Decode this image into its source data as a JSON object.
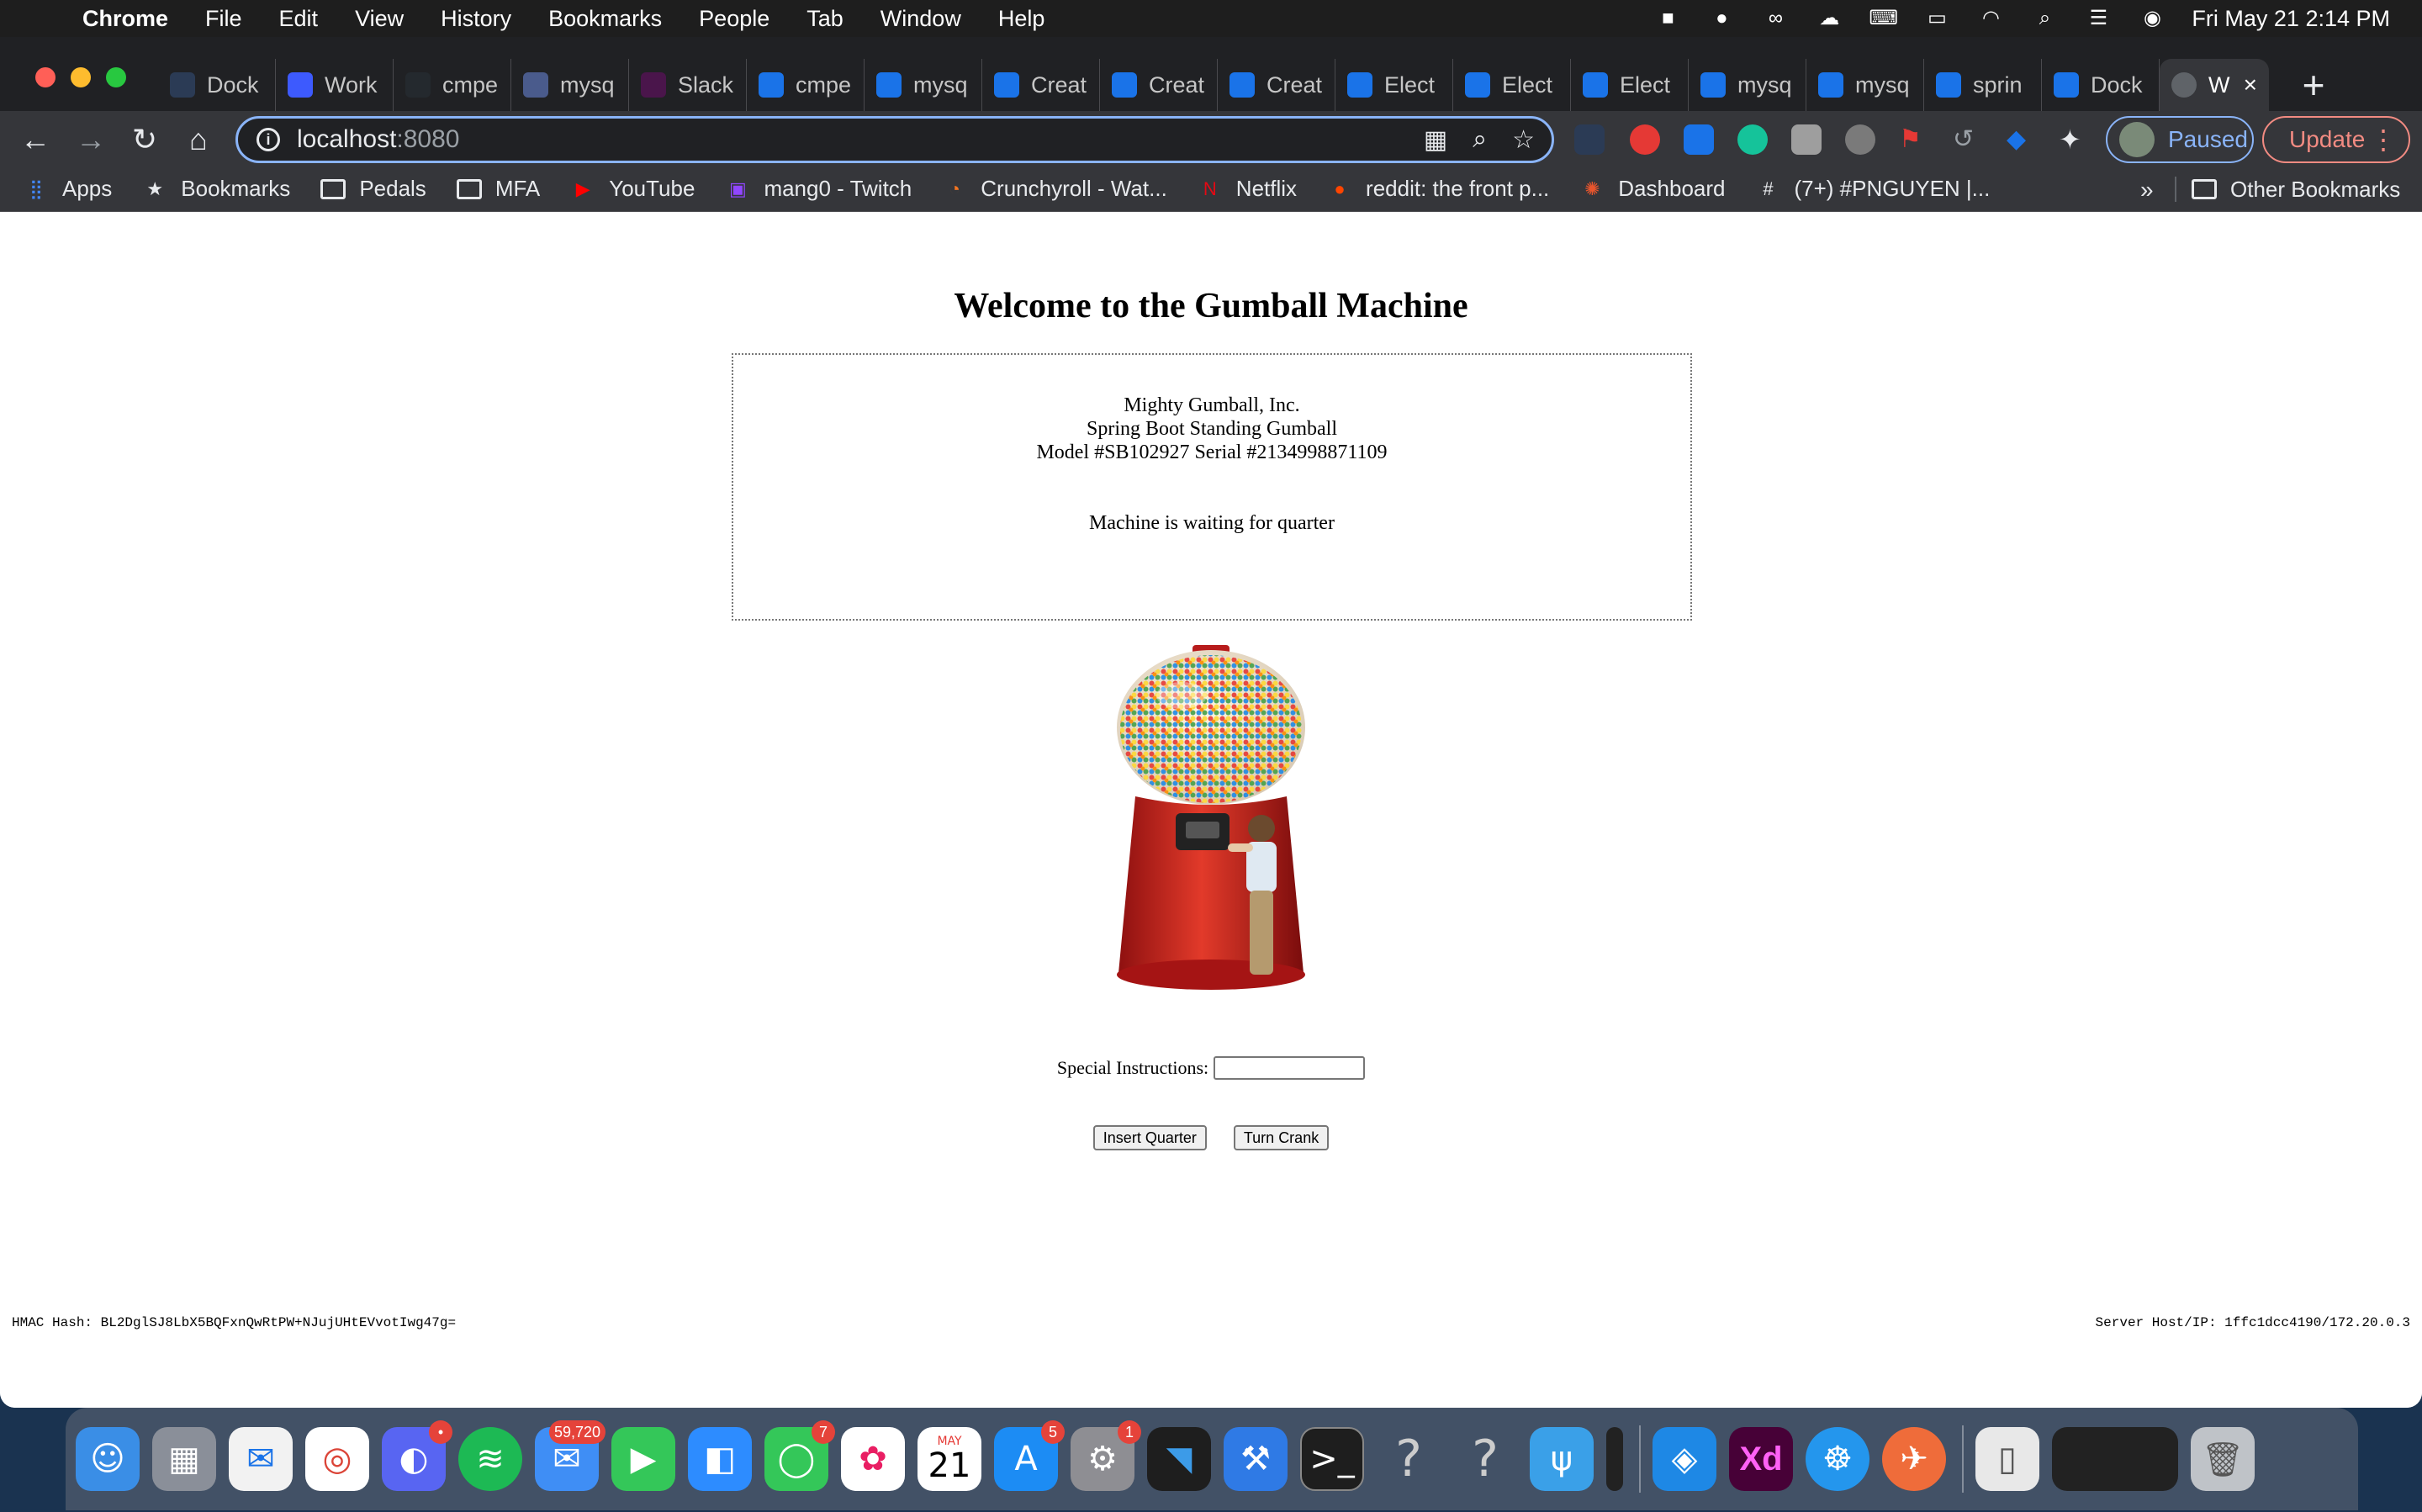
{
  "menubar": {
    "app": "Chrome",
    "items": [
      "File",
      "Edit",
      "View",
      "History",
      "Bookmarks",
      "People",
      "Tab",
      "Window",
      "Help"
    ],
    "datetime": "Fri May 21  2:14 PM"
  },
  "tabs": [
    {
      "label": "Dock",
      "color": "#2b3b55"
    },
    {
      "label": "Work",
      "color": "#3d5afe"
    },
    {
      "label": "cmpe",
      "color": "#24292e"
    },
    {
      "label": "mysq",
      "color": "#4a5b8c"
    },
    {
      "label": "Slack",
      "color": "#4a154b"
    },
    {
      "label": "cmpe",
      "color": "#1a73e8"
    },
    {
      "label": "mysq",
      "color": "#1a73e8"
    },
    {
      "label": "Creat",
      "color": "#1a73e8"
    },
    {
      "label": "Creat",
      "color": "#1a73e8"
    },
    {
      "label": "Creat",
      "color": "#1a73e8"
    },
    {
      "label": "Elect",
      "color": "#1a73e8"
    },
    {
      "label": "Elect",
      "color": "#1a73e8"
    },
    {
      "label": "Elect",
      "color": "#1a73e8"
    },
    {
      "label": "mysq",
      "color": "#1a73e8"
    },
    {
      "label": "mysq",
      "color": "#1a73e8"
    },
    {
      "label": "sprin",
      "color": "#1a73e8"
    },
    {
      "label": "Dock",
      "color": "#1a73e8"
    }
  ],
  "active_tab": {
    "label": "W"
  },
  "omnibox": {
    "host": "localhost",
    "port": ":8080"
  },
  "profile": {
    "label": "Paused"
  },
  "update": {
    "label": "Update"
  },
  "bookmarks": [
    {
      "label": "Apps",
      "icon": "apps-grid-icon"
    },
    {
      "label": "Bookmarks",
      "icon": "star-icon"
    },
    {
      "label": "Pedals",
      "icon": "folder-icon"
    },
    {
      "label": "MFA",
      "icon": "folder-icon"
    },
    {
      "label": "YouTube",
      "icon": "youtube-icon"
    },
    {
      "label": "mang0 - Twitch",
      "icon": "twitch-icon"
    },
    {
      "label": "Crunchyroll - Wat...",
      "icon": "crunchyroll-icon"
    },
    {
      "label": "Netflix",
      "icon": "netflix-icon"
    },
    {
      "label": "reddit: the front p...",
      "icon": "reddit-icon"
    },
    {
      "label": "Dashboard",
      "icon": "dashboard-icon"
    },
    {
      "label": "(7+) #PNGUYEN |...",
      "icon": "slack-icon"
    }
  ],
  "bookmarks_more": "»",
  "other_bookmarks": "Other Bookmarks",
  "page": {
    "title": "Welcome to the Gumball Machine",
    "company": "Mighty Gumball, Inc.",
    "product": "Spring Boot Standing Gumball",
    "model": "Model #SB102927 Serial #2134998871109",
    "status": "Machine is waiting for quarter",
    "instructions_label": "Special Instructions:",
    "instructions_value": "",
    "insert_quarter": "Insert Quarter",
    "turn_crank": "Turn Crank",
    "hmac": "HMAC Hash:  BL2DglSJ8LbX5BQFxnQwRtPW+NJujUHtEVvotIwg47g=",
    "server": "Server Host/IP:  1ffc1dcc4190/172.20.0.3"
  },
  "dock": {
    "badges": {
      "discord": "•",
      "mail": "59,720",
      "messages": "7",
      "appstore": "5",
      "settings": "1"
    },
    "calendar": {
      "month": "MAY",
      "day": "21"
    }
  }
}
